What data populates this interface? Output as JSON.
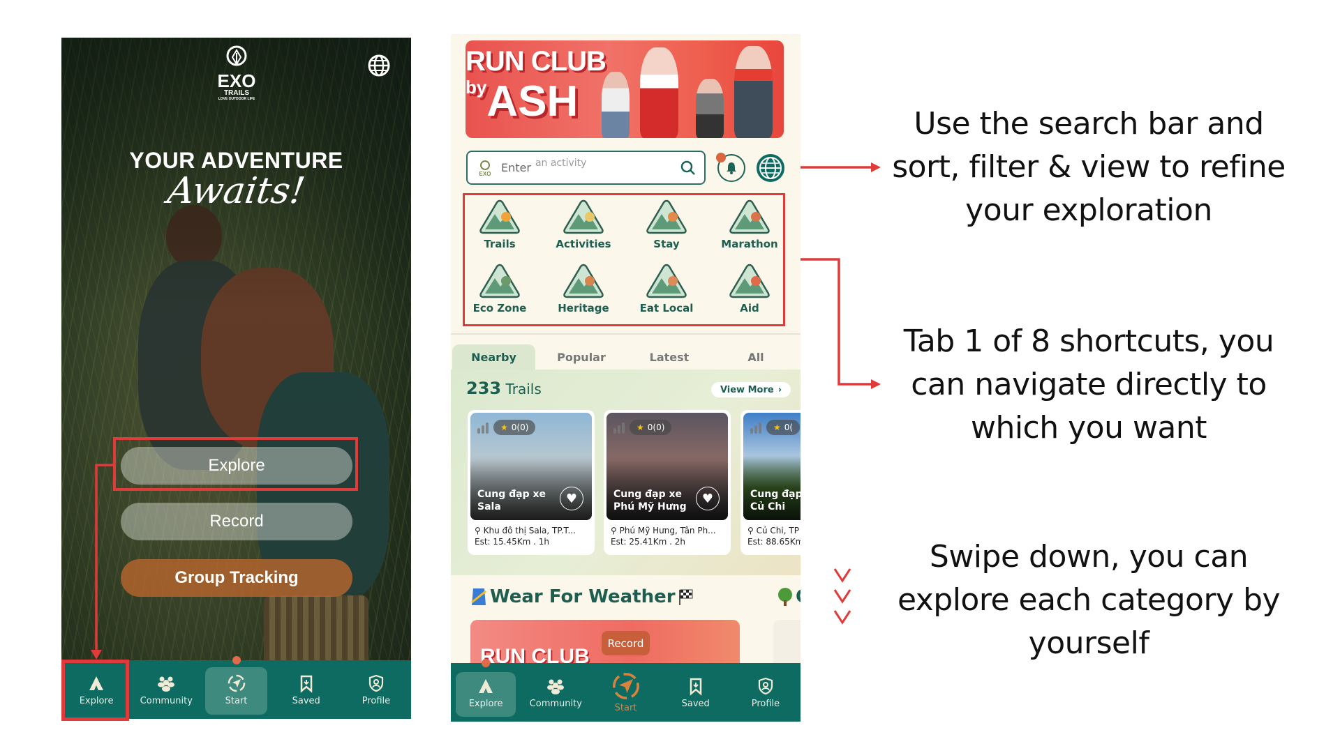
{
  "left_screen": {
    "logo": {
      "brand": "EXO",
      "sub": "TRAILS",
      "tagline": "LOVE OUTDOOR LIFE"
    },
    "language_icon": "globe-icon",
    "headline": "YOUR ADVENTURE",
    "headline_script": "Awaits!",
    "buttons": {
      "explore": "Explore",
      "record": "Record",
      "group_tracking": "Group Tracking"
    },
    "bottom_nav": [
      {
        "label": "Explore",
        "icon": "tent-icon"
      },
      {
        "label": "Community",
        "icon": "community-icon"
      },
      {
        "label": "Start",
        "icon": "compass-icon",
        "active": true
      },
      {
        "label": "Saved",
        "icon": "bookmark-icon"
      },
      {
        "label": "Profile",
        "icon": "profile-shield-icon"
      }
    ]
  },
  "right_screen": {
    "banner": {
      "line1": "RUN CLUB",
      "line2_prefix": "by",
      "line2": "ASH"
    },
    "search": {
      "placeholder_start": "Enter",
      "placeholder_rest": "an activity"
    },
    "shortcuts": [
      {
        "label": "Trails",
        "icon": "mountain-icon"
      },
      {
        "label": "Activities",
        "icon": "shoe-icon"
      },
      {
        "label": "Stay",
        "icon": "tent-icon"
      },
      {
        "label": "Marathon",
        "icon": "runners-icon"
      },
      {
        "label": "Eco Zone",
        "icon": "earth-icon"
      },
      {
        "label": "Heritage",
        "icon": "pagoda-icon"
      },
      {
        "label": "Eat Local",
        "icon": "utensils-icon"
      },
      {
        "label": "Aid",
        "icon": "first-aid-icon"
      }
    ],
    "tabs": [
      "Nearby",
      "Popular",
      "Latest",
      "All"
    ],
    "active_tab": "Nearby",
    "trail_count": "233",
    "trail_count_label": "Trails",
    "view_more": "View More",
    "trails": [
      {
        "title_l1": "Cung đạp xe",
        "title_l2": "Sala",
        "rating": "0(0)",
        "location": "Khu đô thị Sala, TP.T...",
        "est": "Est: 15.45Km . 1h"
      },
      {
        "title_l1": "Cung đạp xe",
        "title_l2": "Phú Mỹ Hưng",
        "rating": "0(0)",
        "location": "Phú Mỹ Hưng, Tân Ph...",
        "est": "Est: 25.41Km . 2h"
      },
      {
        "title_l1": "Cung đạp",
        "title_l2": "Củ Chi",
        "rating": "0(",
        "location": "Củ Chi, TP",
        "est": "Est: 88.65Km"
      }
    ],
    "section_title": "Wear For Weather",
    "section_next_partial": "G",
    "promo_text": "RUN CLUB",
    "record_tooltip": "Record",
    "bottom_nav": [
      {
        "label": "Explore",
        "icon": "tent-icon",
        "active": true
      },
      {
        "label": "Community",
        "icon": "community-icon"
      },
      {
        "label": "Start",
        "icon": "compass-icon"
      },
      {
        "label": "Saved",
        "icon": "bookmark-icon"
      },
      {
        "label": "Profile",
        "icon": "profile-shield-icon"
      }
    ]
  },
  "annotations": {
    "search": [
      "Use the search bar and",
      "sort, filter & view to refine",
      "your exploration"
    ],
    "shortcuts": [
      "Tab 1 of 8 shortcuts,  you",
      "can navigate directly to",
      "which you want"
    ],
    "swipe": [
      "Swipe down,  you can",
      "explore each category by",
      "yourself"
    ]
  },
  "colors": {
    "teal_nav": "#0e6b61",
    "dark_green_text": "#1d5e50",
    "annotation_red": "#e03a3a",
    "accent_orange": "#c7603a"
  }
}
